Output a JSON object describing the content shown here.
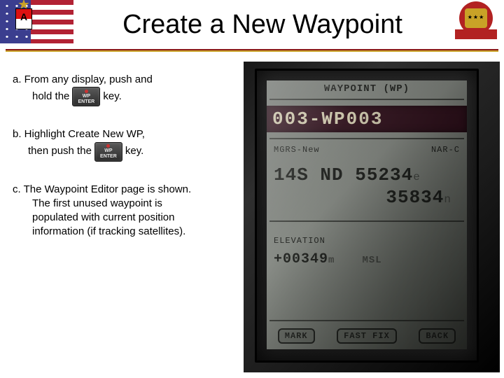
{
  "title": "Create a New Waypoint",
  "key": {
    "top": "WP",
    "bottom": "ENTER"
  },
  "steps": {
    "a_pre": "a.  From any display, push and",
    "a_hold": "hold the",
    "a_post": "key.",
    "b_pre": "b. Highlight Create New WP,",
    "b_then": "then push the",
    "b_post": "key.",
    "c_l1": "c. The Waypoint Editor page is shown.",
    "c_l2": "The first unused waypoint is",
    "c_l3": "populated with current position",
    "c_l4": "information (if tracking satellites)."
  },
  "device": {
    "page_title": "WAYPOINT (WP)",
    "wp_id": "003-WP003",
    "format_left": "MGRS-New",
    "format_right": "NAR-C",
    "coord_line1": "14S ND 55234",
    "coord_unit1": "e",
    "coord_line2": "35834",
    "coord_unit2": "n",
    "elev_label": "ELEVATION",
    "elev_value": "+00349",
    "elev_unit": "m",
    "elev_ref": "MSL",
    "soft_left": "MARK",
    "soft_mid": "FAST FIX",
    "soft_right": "BACK"
  }
}
